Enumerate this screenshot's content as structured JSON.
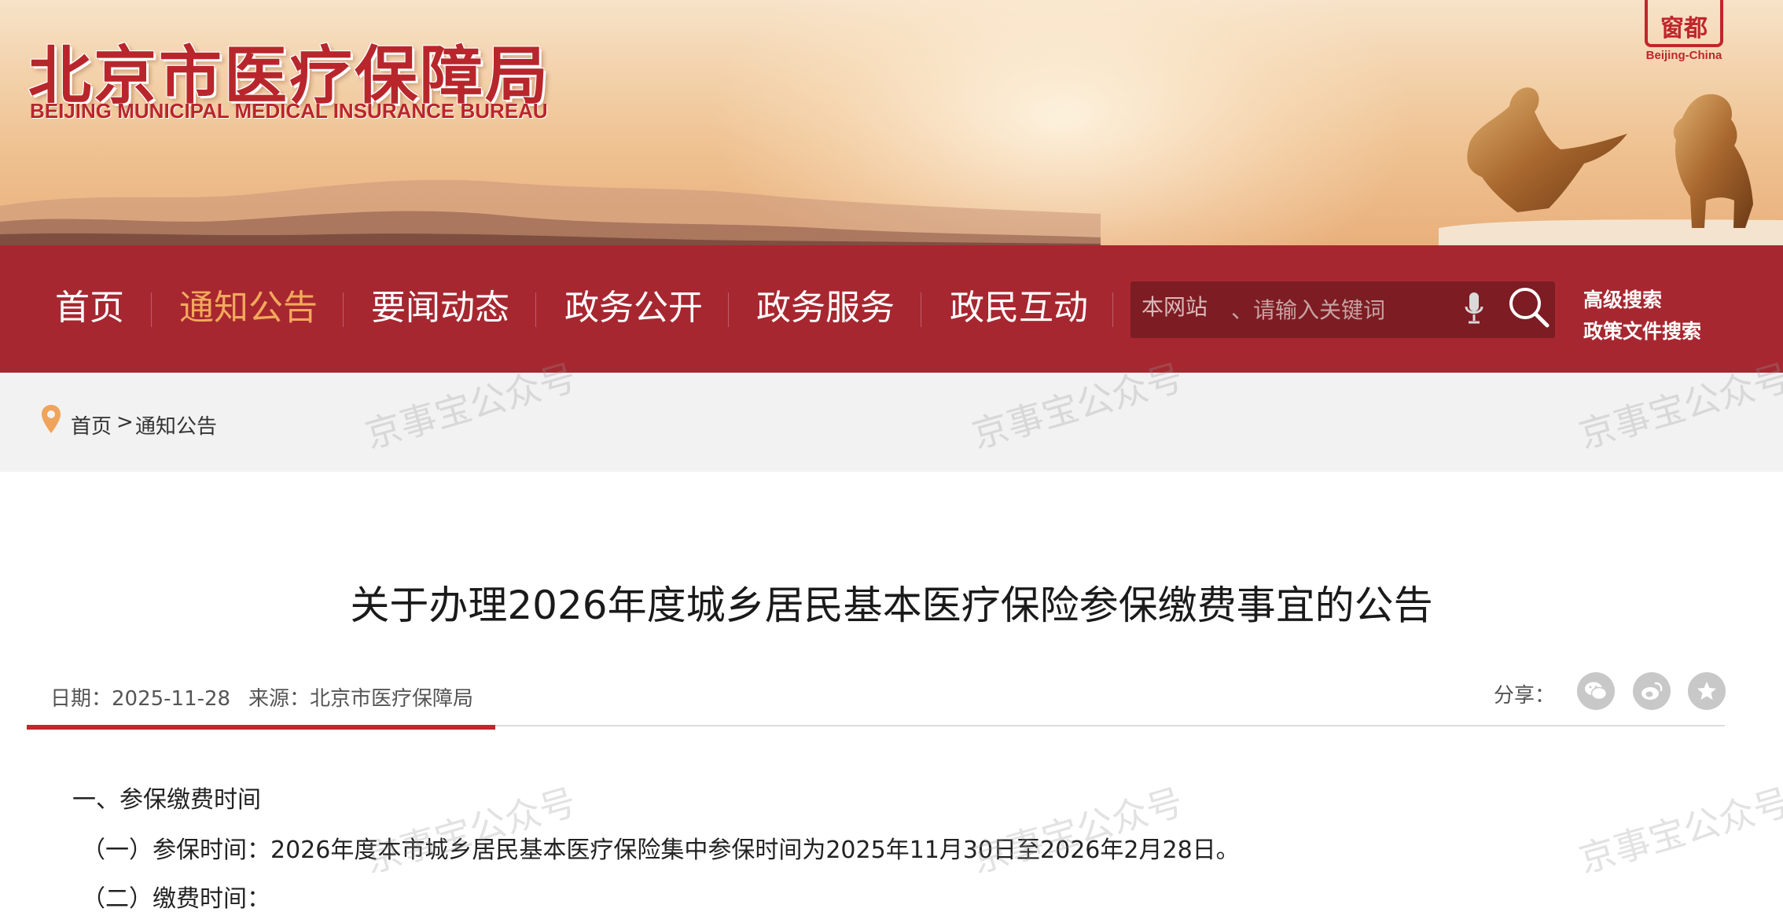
{
  "header": {
    "logo_cn": "北京市医疗保障局",
    "logo_en": "BEIJING MUNICIPAL MEDICAL INSURANCE BUREAU",
    "seal_chars": "窗都",
    "seal_caption": "Beijing-China"
  },
  "nav": {
    "items": [
      {
        "label": "首页",
        "active": false
      },
      {
        "label": "通知公告",
        "active": true
      },
      {
        "label": "要闻动态",
        "active": false
      },
      {
        "label": "政务公开",
        "active": false
      },
      {
        "label": "政务服务",
        "active": false
      },
      {
        "label": "政民互动",
        "active": false
      }
    ],
    "search": {
      "scope": "本网站",
      "placeholder": "、请输入关键词"
    },
    "advanced_search": "高级搜索",
    "policy_search": "政策文件搜索"
  },
  "breadcrumb": {
    "home": "首页",
    "separator": ">",
    "current": "通知公告"
  },
  "article": {
    "title": "关于办理2026年度城乡居民基本医疗保险参保缴费事宜的公告",
    "date": "日期：2025-11-28",
    "source": "来源：北京市医疗保障局",
    "share_label": "分享：",
    "share_icons": [
      "wechat-icon",
      "weibo-icon",
      "favorite-icon"
    ],
    "body": [
      "一、参保缴费时间",
      "（一）参保时间：2026年度本市城乡居民基本医疗保险集中参保时间为2025年11月30日至2026年2月28日。",
      "（二）缴费时间："
    ]
  },
  "watermark": "京事宝公众号",
  "colors": {
    "nav_bg": "#a72730",
    "nav_active": "#f3a85c",
    "brand_red": "#b8262c",
    "crumb_bg": "#f2f2f2"
  }
}
